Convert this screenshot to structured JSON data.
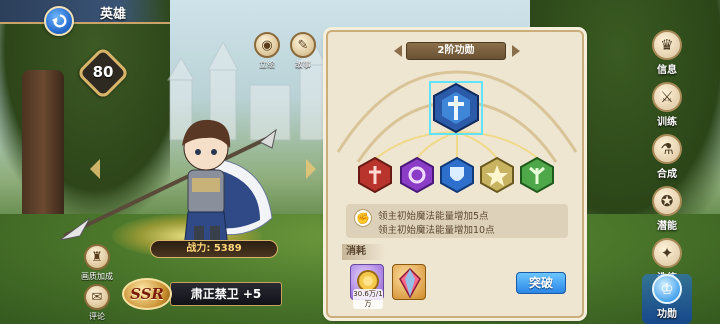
{
  "header": {
    "title": "英雄"
  },
  "hero": {
    "level": "80",
    "power": "战力: 5389",
    "rarity": "SSR",
    "name": "肃正禁卫 +5",
    "actions": [
      {
        "label": "立绘",
        "icon": "portrait-icon"
      },
      {
        "label": "故事",
        "icon": "book-icon"
      },
      {
        "label": "画质加成",
        "icon": "bonus-icon"
      },
      {
        "label": "评论",
        "icon": "comment-icon"
      }
    ]
  },
  "panel": {
    "rank_title": "2阶功勋",
    "effects": [
      "领主初始魔法能量增加5点",
      "领主初始魔法能量增加10点"
    ],
    "cost_label": "消耗",
    "costs": [
      {
        "count": "30.6万/1万",
        "icon": "coin-icon"
      },
      {
        "count": "",
        "icon": "crystal-icon"
      }
    ],
    "breakthrough_label": "突破"
  },
  "side_tabs": [
    {
      "label": "信息",
      "icon": "info-icon",
      "active": false
    },
    {
      "label": "训练",
      "icon": "training-icon",
      "active": false
    },
    {
      "label": "合成",
      "icon": "merge-icon",
      "active": false
    },
    {
      "label": "潜能",
      "icon": "potential-icon",
      "active": false
    },
    {
      "label": "洗练",
      "icon": "refine-icon",
      "active": false
    },
    {
      "label": "功勋",
      "icon": "merit-icon",
      "active": true
    }
  ],
  "colors": {
    "accent_gold": "#d9b56a",
    "button_blue": "#2b86e6",
    "panel_bg": "#efe6d2"
  }
}
